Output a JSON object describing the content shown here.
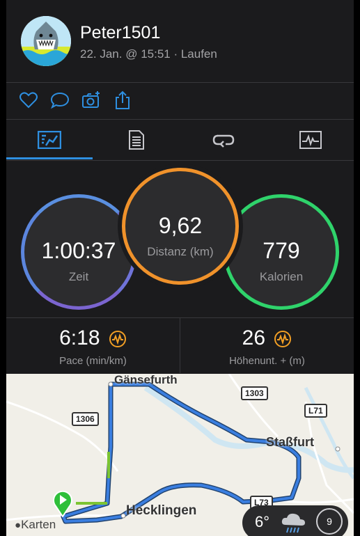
{
  "header": {
    "username": "Peter1501",
    "subline": "22. Jan. @ 15:51 · Laufen"
  },
  "actions": [
    {
      "icon": "heart-icon"
    },
    {
      "icon": "comment-icon"
    },
    {
      "icon": "add-photo-icon"
    },
    {
      "icon": "share-icon"
    }
  ],
  "tabs": [
    {
      "icon": "overview-icon",
      "active": true
    },
    {
      "icon": "details-icon"
    },
    {
      "icon": "laps-icon"
    },
    {
      "icon": "charts-icon"
    }
  ],
  "colors": {
    "accent": "#2e8fe0",
    "time_ring": "#6f73d8",
    "distance_ring": "#f0922b",
    "calories_ring": "#2fd36b",
    "orange_icon": "#f29f25",
    "route": "#3a7ee0",
    "route_green": "#7cc432"
  },
  "metrics": {
    "time": {
      "value": "1:00:37",
      "label": "Zeit"
    },
    "distance": {
      "value": "9,62",
      "label": "Distanz (km)"
    },
    "calories": {
      "value": "779",
      "label": "Kalorien"
    }
  },
  "stats": {
    "pace": {
      "value": "6:18",
      "label": "Pace (min/km)"
    },
    "elevation": {
      "value": "26",
      "label": "Höhenunt. + (m)"
    }
  },
  "map": {
    "places": {
      "gansefurth": "Gänsefurth",
      "stassfurt": "Staßfurt",
      "hecklingen": "Hecklingen"
    },
    "roads": {
      "r1303": "1303",
      "r1306": "1306",
      "l71": "L71",
      "l73": "L73"
    },
    "attribution": "Karten",
    "weather": {
      "temperature": "6°",
      "wind": "9"
    }
  }
}
